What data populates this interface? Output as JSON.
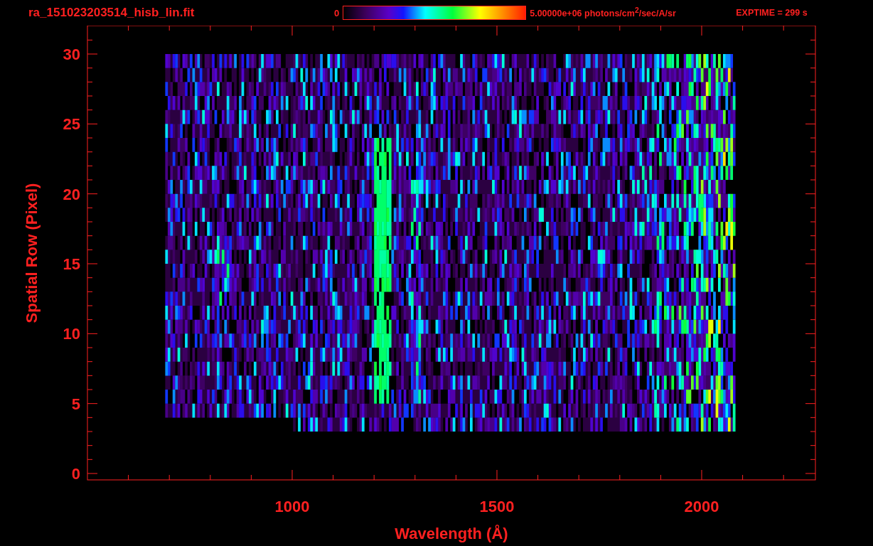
{
  "header": {
    "title": "ra_151023203514_hisb_lin.fit",
    "colorbar_min": "0",
    "colorbar_max": "5.00000e+06 photons/cm$^{2}$/sec/A/sr",
    "exptime": "EXPTIME = 299 s"
  },
  "plot": {
    "ylabel": "Spatial Row (Pixel)",
    "xlabel": "Wavelength (Å)",
    "yticks": [
      "30",
      "25",
      "20",
      "15",
      "10",
      "5",
      "0"
    ],
    "xticks": [
      "1000",
      "1500",
      "2000"
    ]
  }
}
